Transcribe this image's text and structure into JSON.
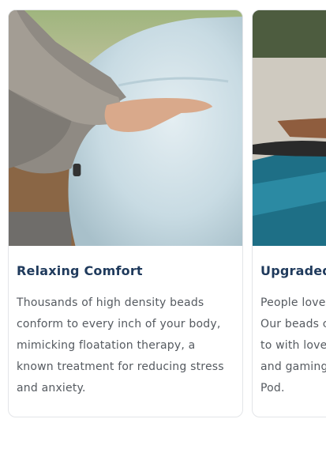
{
  "cards": [
    {
      "title": "Relaxing Comfort",
      "body": "Thousands of high density beads conform to every inch of your body, mimicking floatation therapy, a known treatment for reducing stress and anxiety.",
      "image": "person-on-bean-bag-photo"
    },
    {
      "title": "Upgraded",
      "body_lines": [
        "People love",
        "Our beads c",
        "to with love",
        "and gaming",
        "Pod."
      ],
      "image": "poolside-people-photo"
    }
  ],
  "colors": {
    "title": "#1f3a5c",
    "body": "#555a60",
    "border": "#e3e5e8"
  }
}
